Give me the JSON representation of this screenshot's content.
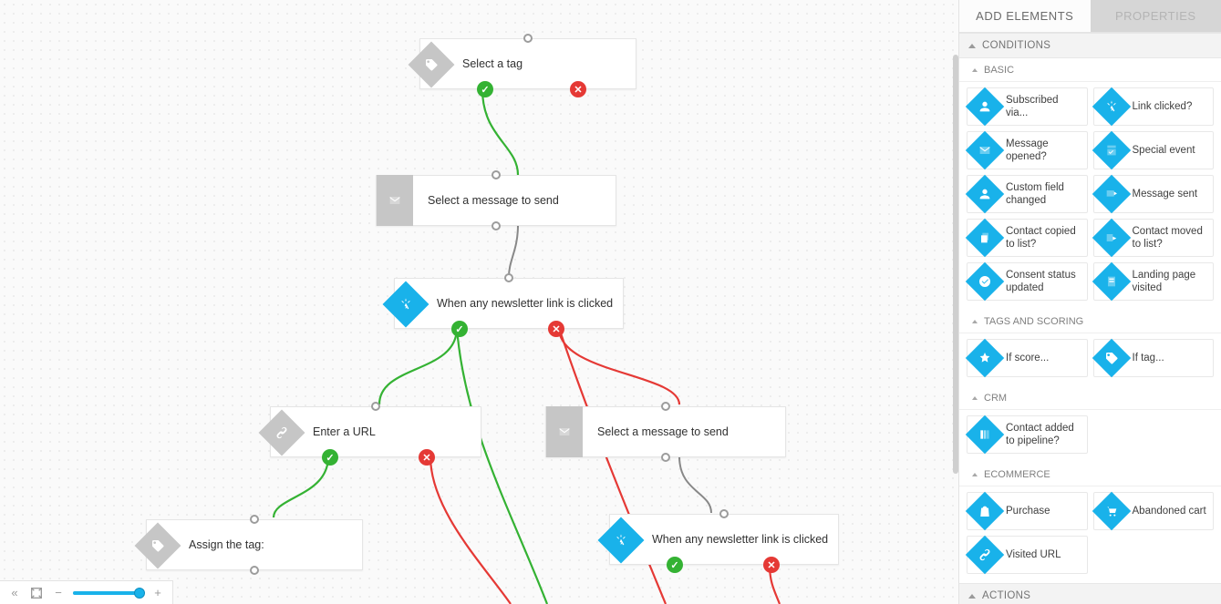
{
  "tabs": {
    "add": "ADD ELEMENTS",
    "props": "PROPERTIES"
  },
  "sections": {
    "conditions": "CONDITIONS",
    "actions": "ACTIONS",
    "basic": "BASIC",
    "tags": "TAGS AND SCORING",
    "crm": "CRM",
    "ecom": "ECOMMERCE"
  },
  "palette": {
    "basic": [
      {
        "label": "Subscribed via...",
        "icon": "person"
      },
      {
        "label": "Link clicked?",
        "icon": "click"
      },
      {
        "label": "Message opened?",
        "icon": "mail"
      },
      {
        "label": "Special event",
        "icon": "event"
      },
      {
        "label": "Custom field changed",
        "icon": "person"
      },
      {
        "label": "Message sent",
        "icon": "mail-out"
      },
      {
        "label": "Contact copied to list?",
        "icon": "copy"
      },
      {
        "label": "Contact moved to list?",
        "icon": "move"
      },
      {
        "label": "Consent status updated",
        "icon": "check"
      },
      {
        "label": "Landing page visited",
        "icon": "page"
      }
    ],
    "tags": [
      {
        "label": "If score...",
        "icon": "star"
      },
      {
        "label": "If tag...",
        "icon": "tag"
      }
    ],
    "crm": [
      {
        "label": "Contact added to pipeline?",
        "icon": "pipeline"
      }
    ],
    "ecom": [
      {
        "label": "Purchase",
        "icon": "bag"
      },
      {
        "label": "Abandoned cart",
        "icon": "cart"
      },
      {
        "label": "Visited URL",
        "icon": "link"
      }
    ]
  },
  "nodes": {
    "n1": {
      "label": "Select a tag",
      "icon": "tag",
      "type": "condition-grey"
    },
    "n2": {
      "label": "Select a message to send",
      "icon": "mail",
      "type": "action"
    },
    "n3": {
      "label": "When any newsletter link is clicked",
      "icon": "click",
      "type": "condition-blue"
    },
    "n4": {
      "label": "Enter a URL",
      "icon": "link",
      "type": "action-grey"
    },
    "n5": {
      "label": "Select a message to send",
      "icon": "mail",
      "type": "action"
    },
    "n6": {
      "label": "Assign the tag:",
      "icon": "tag",
      "type": "action-grey"
    },
    "n7": {
      "label": "When any newsletter link is clicked",
      "icon": "click",
      "type": "condition-blue"
    }
  },
  "colors": {
    "blue": "#19b2ea",
    "green": "#34b233",
    "red": "#e53935",
    "grey": "#c6c6c6"
  },
  "zoom": {
    "percent": 95
  }
}
